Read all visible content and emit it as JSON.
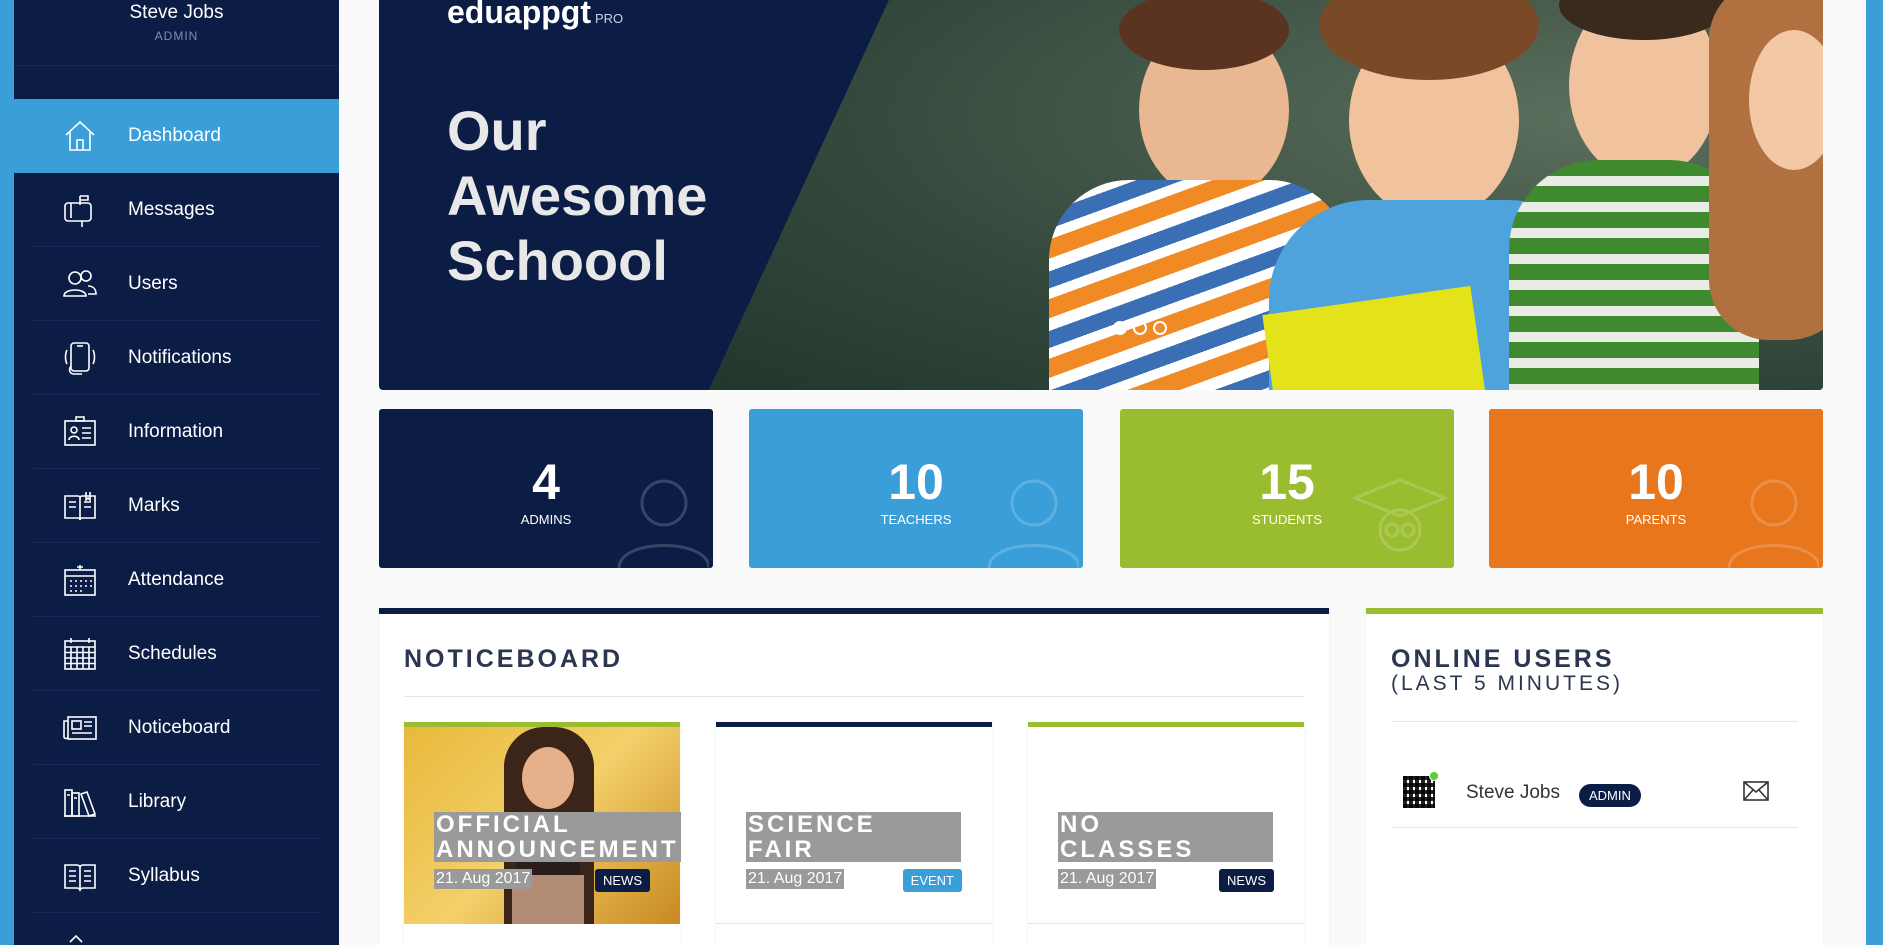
{
  "sidebar": {
    "user": {
      "name": "Steve Jobs",
      "role": "ADMIN"
    },
    "items": [
      {
        "label": "Dashboard",
        "icon": "home-icon",
        "active": true
      },
      {
        "label": "Messages",
        "icon": "mailbox-icon"
      },
      {
        "label": "Users",
        "icon": "users-icon"
      },
      {
        "label": "Notifications",
        "icon": "phone-notification-icon"
      },
      {
        "label": "Information",
        "icon": "id-card-icon"
      },
      {
        "label": "Marks",
        "icon": "book-open-icon"
      },
      {
        "label": "Attendance",
        "icon": "calendar-icon"
      },
      {
        "label": "Schedules",
        "icon": "grid-calendar-icon"
      },
      {
        "label": "Noticeboard",
        "icon": "newspaper-icon"
      },
      {
        "label": "Library",
        "icon": "books-icon"
      },
      {
        "label": "Syllabus",
        "icon": "open-book-icon"
      }
    ]
  },
  "hero": {
    "brand": "eduappgt",
    "brand_suffix": "PRO",
    "title_line1": "Our",
    "title_line2": "Awesome",
    "title_line3": "Schoool",
    "slide_count": 3,
    "active_slide": 1
  },
  "stats": [
    {
      "value": "4",
      "label": "ADMINS",
      "color": "#0b1d45"
    },
    {
      "value": "10",
      "label": "TEACHERS",
      "color": "#3a9fd8"
    },
    {
      "value": "15",
      "label": "STUDENTS",
      "color": "#9abc2f"
    },
    {
      "value": "10",
      "label": "PARENTS",
      "color": "#e8761d"
    }
  ],
  "noticeboard": {
    "title": "NOTICEBOARD",
    "items": [
      {
        "title_line1": "OFFICIAL",
        "title_line2": "ANNOUNCEMENT",
        "date": "21. Aug 2017",
        "tag": "NEWS",
        "tag_color": "#0b1d45",
        "accent": "#9abc2f"
      },
      {
        "title_line1": "SCIENCE",
        "title_line2": "FAIR",
        "date": "21. Aug 2017",
        "tag": "EVENT",
        "tag_color": "#3a9fd8",
        "accent": "#0b1d45"
      },
      {
        "title_line1": "NO",
        "title_line2": "CLASSES",
        "date": "21. Aug 2017",
        "tag": "NEWS",
        "tag_color": "#0b1d45",
        "accent": "#9abc2f"
      }
    ]
  },
  "online_users": {
    "title": "ONLINE USERS",
    "subtitle": "(LAST 5 MINUTES)",
    "users": [
      {
        "name": "Steve Jobs",
        "role": "ADMIN",
        "avatar": "qr-code-avatar",
        "status": "online"
      }
    ]
  }
}
